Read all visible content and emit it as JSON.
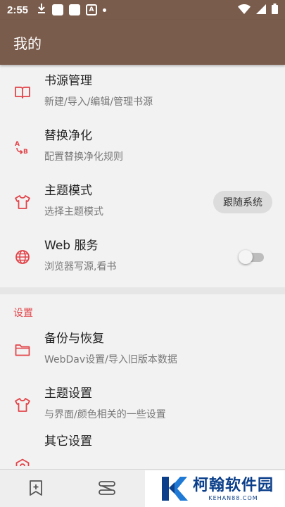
{
  "status_bar": {
    "time": "2:55",
    "a_badge": "A"
  },
  "app_bar": {
    "title": "我的"
  },
  "menu": [
    {
      "title": "书源管理",
      "subtitle": "新建/导入/编辑/管理书源",
      "icon": "book-open-icon"
    },
    {
      "title": "替换净化",
      "subtitle": "配置替换净化规则",
      "icon": "replace-ab-icon"
    },
    {
      "title": "主题模式",
      "subtitle": "选择主题模式",
      "icon": "tshirt-icon",
      "button_label": "跟随系统"
    },
    {
      "title": "Web 服务",
      "subtitle": "浏览器写源,看书",
      "icon": "globe-icon",
      "toggle_on": false
    }
  ],
  "settings_section": {
    "header": "设置",
    "items": [
      {
        "title": "备份与恢复",
        "subtitle": "WebDav设置/导入旧版本数据",
        "icon": "folder-icon"
      },
      {
        "title": "主题设置",
        "subtitle": "与界面/颜色相关的一些设置",
        "icon": "tshirt-icon"
      },
      {
        "title": "其它设置",
        "subtitle": "",
        "icon": "hexagon-gear-icon"
      }
    ]
  },
  "bottom_nav": {
    "items": [
      {
        "icon": "bookmark-add-icon"
      },
      {
        "icon": "explore-icon"
      }
    ]
  },
  "watermark": {
    "title": "柯翰软件园",
    "subtitle": "KEHAN88.COM"
  },
  "colors": {
    "primary": "#7a5c4c",
    "accent": "#e2454a",
    "background": "#f2f2f2"
  }
}
